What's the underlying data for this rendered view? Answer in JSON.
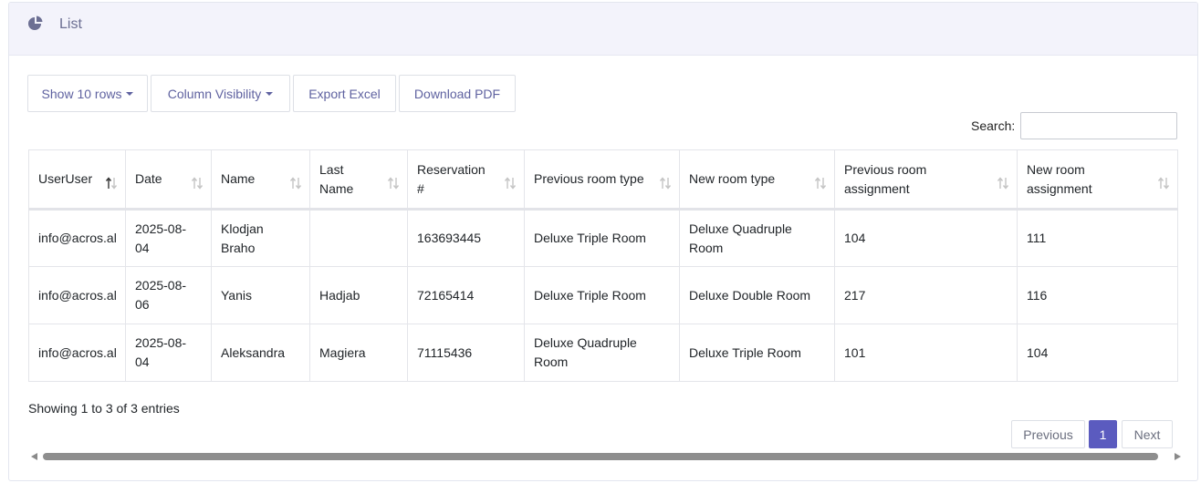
{
  "header": {
    "title": "List",
    "icon": "pie-chart-icon"
  },
  "toolbar": {
    "show_rows": "Show 10 rows",
    "column_visibility": "Column Visibility",
    "export_excel": "Export Excel",
    "download_pdf": "Download PDF"
  },
  "search": {
    "label": "Search:",
    "value": ""
  },
  "table": {
    "columns": [
      [
        "UserUser"
      ],
      [
        "Date"
      ],
      [
        "Name"
      ],
      [
        "Last",
        "Name"
      ],
      [
        "Reservation",
        "#"
      ],
      [
        "Previous room type"
      ],
      [
        "New room type"
      ],
      [
        "Previous room",
        "assignment"
      ],
      [
        "New room",
        "assignment"
      ]
    ],
    "sorted_column": 0,
    "rows": [
      [
        [
          "info@acros.al"
        ],
        [
          "2025-08-",
          "04"
        ],
        [
          "Klodjan",
          "Braho"
        ],
        [
          ""
        ],
        [
          "163693445"
        ],
        [
          "Deluxe Triple Room"
        ],
        [
          "Deluxe Quadruple",
          "Room"
        ],
        [
          "104"
        ],
        [
          "111"
        ]
      ],
      [
        [
          "info@acros.al"
        ],
        [
          "2025-08-",
          "06"
        ],
        [
          "Yanis"
        ],
        [
          "Hadjab"
        ],
        [
          "72165414"
        ],
        [
          "Deluxe Triple Room"
        ],
        [
          "Deluxe Double Room"
        ],
        [
          "217"
        ],
        [
          "116"
        ]
      ],
      [
        [
          "info@acros.al"
        ],
        [
          "2025-08-",
          "04"
        ],
        [
          "Aleksandra"
        ],
        [
          "Magiera"
        ],
        [
          "71115436"
        ],
        [
          "Deluxe Quadruple",
          "Room"
        ],
        [
          "Deluxe Triple Room"
        ],
        [
          "101"
        ],
        [
          "104"
        ]
      ]
    ]
  },
  "footer": {
    "info": "Showing 1 to 3 of 3 entries"
  },
  "pagination": {
    "previous": "Previous",
    "current": "1",
    "next": "Next"
  },
  "colors": {
    "accent": "#5b5bbf",
    "button_text": "#5f62a0",
    "header_bg": "#f3f3fb"
  }
}
